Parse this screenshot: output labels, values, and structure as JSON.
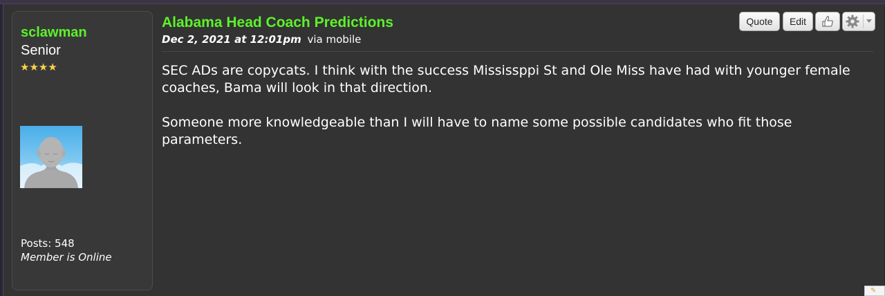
{
  "post": {
    "author": {
      "username": "sclawman",
      "rank": "Senior",
      "stars": "★★★★",
      "posts_label": "Posts: 548",
      "status": "Member is Online"
    },
    "title": "Alabama Head Coach Predictions",
    "date": "Dec 2, 2021 at 12:01pm",
    "via": "via mobile",
    "body": [
      "SEC ADs are copycats. I think with the success Mississppi St and Ole Miss have had with younger female coaches, Bama will look in that direction.",
      "Someone more knowledgeable than I will have to name some possible candidates who fit those parameters."
    ]
  },
  "toolbar": {
    "quote_label": "Quote",
    "edit_label": "Edit",
    "like_icon": "like-hand-icon",
    "options_icon": "gear-icon"
  },
  "colors": {
    "accent_green": "#5df22a",
    "post_background": "#333333",
    "page_background": "#2a2536"
  }
}
